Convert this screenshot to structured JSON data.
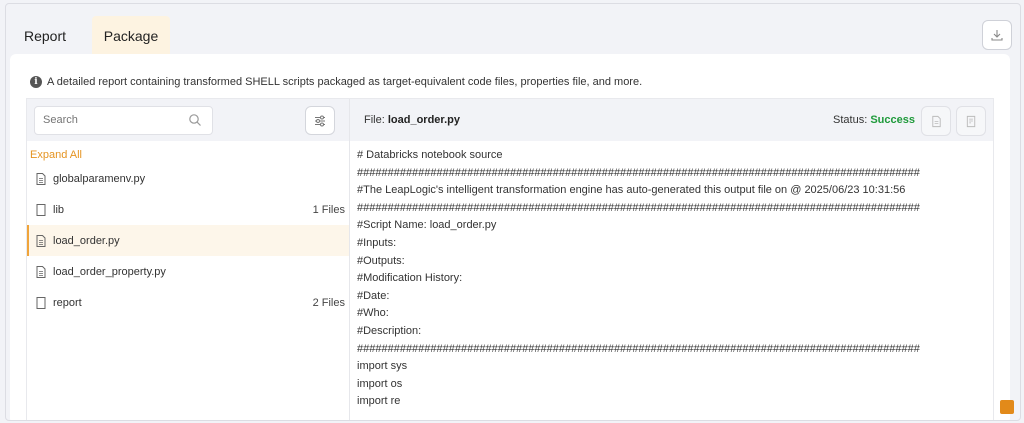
{
  "tabs": {
    "report": "Report",
    "package": "Package"
  },
  "info_text": "A detailed report containing transformed SHELL scripts packaged as target-equivalent code files, properties file, and more.",
  "search": {
    "placeholder": "Search"
  },
  "expand_all": "Expand All",
  "tree": [
    {
      "name": "globalparamenv.py",
      "type": "file",
      "count": ""
    },
    {
      "name": "lib",
      "type": "folder",
      "count": "1 Files"
    },
    {
      "name": "load_order.py",
      "type": "file",
      "count": "",
      "selected": true
    },
    {
      "name": "load_order_property.py",
      "type": "file",
      "count": ""
    },
    {
      "name": "report",
      "type": "folder",
      "count": "2 Files"
    }
  ],
  "file": {
    "label": "File:",
    "name": "load_order.py"
  },
  "status": {
    "label": "Status:",
    "value": "Success",
    "color": "#1f9a3b"
  },
  "accent_color": "#f0a43a",
  "code_lines": [
    "# Databricks notebook source",
    "############################################################################################",
    "#The LeapLogic's intelligent transformation engine has auto-generated this output file on @ 2025/06/23 10:31:56",
    "############################################################################################",
    "#Script Name: load_order.py",
    "#Inputs:",
    "#Outputs:",
    "#Modification History:",
    "#Date:",
    "#Who:",
    "#Description:",
    "############################################################################################",
    "import sys",
    "import os",
    "import re"
  ]
}
